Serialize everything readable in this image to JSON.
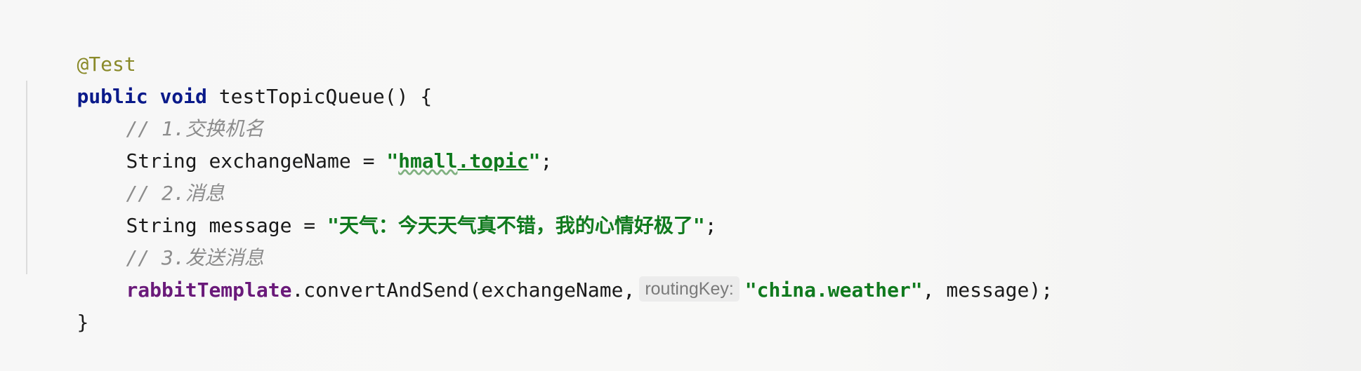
{
  "code": {
    "annotation": "@Test",
    "signature": {
      "keyword_public": "public",
      "keyword_void": "void",
      "method_name": "testTopicQueue() {"
    },
    "comment1": "// 1.交换机名",
    "line_exchange": {
      "type": "String",
      "var_assign": " exchangeName = ",
      "quote_open": "\"",
      "value_part1": "hmall",
      "value_part2": ".topic",
      "quote_close": "\"",
      "semicolon": ";"
    },
    "comment2": "// 2.消息",
    "line_message": {
      "type": "String",
      "var_assign": " message = ",
      "value": "\"天气：今天天气真不错，我的心情好极了\"",
      "semicolon": ";"
    },
    "comment3": "// 3.发送消息",
    "line_send": {
      "field": "rabbitTemplate",
      "call": ".convertAndSend(exchangeName,",
      "param_hint": "routingKey:",
      "routing_value": "\"china.weather\"",
      "rest": ", message);"
    },
    "closing_brace": "}"
  },
  "colors": {
    "keyword": "#0a1a8a",
    "string": "#107a1e",
    "comment": "#8c8c8c",
    "annotation": "#8a8a2a",
    "field": "#6a1a7a"
  }
}
